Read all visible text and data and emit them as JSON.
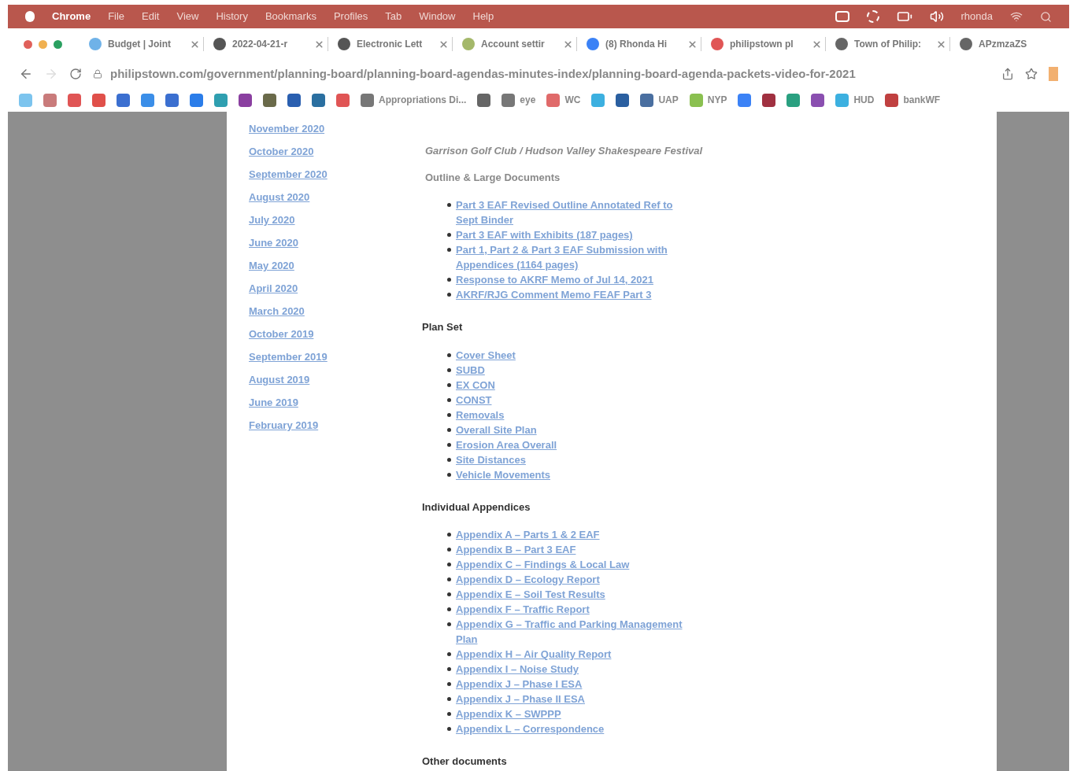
{
  "menu_bar": {
    "items": [
      "Chrome",
      "File",
      "Edit",
      "View",
      "History",
      "Bookmarks",
      "Profiles",
      "Tab",
      "Window",
      "Help"
    ],
    "user": "rhonda"
  },
  "tabs": [
    {
      "label": "Budget | Joint",
      "closable": true,
      "color": "#6fb2e8"
    },
    {
      "label": "2022-04-21-r",
      "closable": true,
      "color": "#555555"
    },
    {
      "label": "Electronic Lett",
      "closable": true,
      "color": "#555555"
    },
    {
      "label": "Account settir",
      "closable": true,
      "color": "#a4b86a"
    },
    {
      "label": "(8) Rhonda Hi",
      "closable": true,
      "color": "#3b82f6"
    },
    {
      "label": "philipstown pl",
      "closable": true,
      "color": "#e05555"
    },
    {
      "label": "Town of Philip:",
      "closable": true,
      "color": "#666666"
    },
    {
      "label": "APzmzaZS",
      "closable": false,
      "color": "#666666"
    }
  ],
  "address_bar": {
    "url": "philipstown.com/government/planning-board/planning-board-agendas-minutes-index/planning-board-agenda-packets-video-for-2021"
  },
  "bookmarks": [
    {
      "color": "#7cc4ee"
    },
    {
      "color": "#c97b7b"
    },
    {
      "color": "#e05555"
    },
    {
      "color": "#e0504a"
    },
    {
      "color": "#3b6fd0"
    },
    {
      "color": "#3b8ee8"
    },
    {
      "color": "#3b6fd0"
    },
    {
      "color": "#2b7de9"
    },
    {
      "color": "#2f9fb0"
    },
    {
      "color": "#8a3fa0"
    },
    {
      "color": "#6a6a4a"
    },
    {
      "color": "#2a5fb0"
    },
    {
      "color": "#2a6fa0"
    },
    {
      "color": "#e05555"
    },
    {
      "label": "Appropriations Di...",
      "color": "#777777"
    },
    {
      "color": "#666666"
    },
    {
      "label": "eye",
      "color": "#777777"
    },
    {
      "label": "WC",
      "color": "#e06a6a"
    },
    {
      "color": "#3cb0e0"
    },
    {
      "color": "#2a5fa0"
    },
    {
      "label": "UAP",
      "color": "#4a6fa0"
    },
    {
      "label": "NYP",
      "color": "#8ac050"
    },
    {
      "color": "#3b82f6"
    },
    {
      "color": "#a03040"
    },
    {
      "color": "#2aa080"
    },
    {
      "color": "#8a4fb0"
    },
    {
      "label": "HUD",
      "color": "#3cb0e0"
    },
    {
      "label": "bankWF",
      "color": "#c04040"
    }
  ],
  "archive_links": [
    "November 2020",
    "October 2020",
    "September 2020",
    "August 2020",
    "July 2020",
    "June 2020",
    "May 2020",
    "April 2020",
    "March 2020",
    "October 2019",
    "September 2019",
    "August 2019",
    "June 2019",
    "February 2019"
  ],
  "content": [
    {
      "kind": "subtitle",
      "text": "Garrison Golf Club / Hudson Valley Shakespeare Festival"
    },
    {
      "kind": "subheading",
      "text": "Outline & Large Documents"
    },
    {
      "kind": "list",
      "items": [
        "Part 3 EAF Revised Outline Annotated Ref to Sept Binder",
        "Part 3 EAF with Exhibits (187 pages)",
        "Part 1, Part 2 & Part 3 EAF Submission with Appendices (1164 pages)",
        "Response to AKRF Memo of Jul 14, 2021",
        "AKRF/RJG Comment Memo FEAF Part 3"
      ]
    },
    {
      "kind": "heading",
      "text": "Plan Set"
    },
    {
      "kind": "list",
      "items": [
        "Cover Sheet",
        "SUBD",
        "EX CON",
        "CONST",
        "Removals",
        "Overall Site Plan",
        "Erosion Area Overall",
        "Site Distances",
        "Vehicle Movements"
      ]
    },
    {
      "kind": "heading",
      "text": "Individual Appendices"
    },
    {
      "kind": "list",
      "items": [
        "Appendix A – Parts 1 & 2 EAF",
        "Appendix B – Part 3 EAF",
        "Appendix C – Findings & Local Law",
        "Appendix D – Ecology Report",
        "Appendix E – Soil Test Results",
        "Appendix F – Traffic Report",
        "Appendix G – Traffic and Parking Management Plan",
        "Appendix H – Air Quality Report",
        "Appendix I – Noise Study",
        "Appendix J – Phase I ESA",
        "Appendix J – Phase II ESA",
        "Appendix K – SWPPP",
        "Appendix L – Correspondence"
      ]
    },
    {
      "kind": "heading",
      "text": "Other documents"
    }
  ]
}
